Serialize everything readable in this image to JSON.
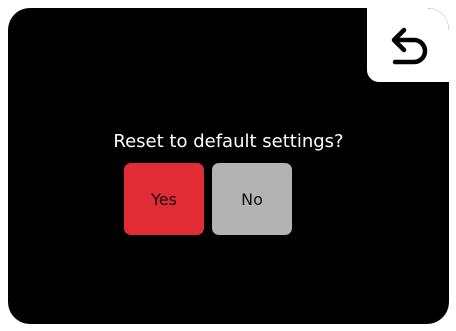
{
  "dialog": {
    "prompt": "Reset to default settings?",
    "yes_label": "Yes",
    "no_label": "No"
  },
  "header": {
    "back_icon": "back-arrow-icon"
  },
  "colors": {
    "background": "#000000",
    "yes_button": "#e12c36",
    "no_button": "#b3b3b3",
    "back_button": "#ffffff",
    "text": "#ffffff"
  }
}
